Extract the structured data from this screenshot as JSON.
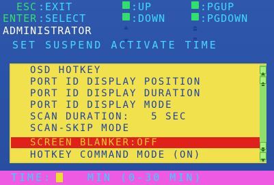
{
  "colors": {
    "background": "#2a52a6",
    "menu_panel": "#f1e24d",
    "menu_text": "#1f41a8",
    "selected_bg": "#e0211b",
    "selected_text": "#f6cd2a",
    "status_bar": "#ee5ae2",
    "hint_cyan": "#3fd8ff",
    "key_green": "#2fe06a"
  },
  "header": {
    "row1": {
      "esc_key": "ESC",
      "esc_action": ":EXIT",
      "up_icon": "up-arrow-icon",
      "up_label": ":UP",
      "pgup_icon": "page-up-icon",
      "pgup_label": ":PGUP"
    },
    "row2": {
      "enter_key": "ENTER",
      "enter_action": ":SELECT",
      "down_icon": "down-arrow-icon",
      "down_label": ":DOWN",
      "pgdown_icon": "page-down-icon",
      "pgdown_label": ":PGDOWN"
    }
  },
  "user": "ADMINISTRATOR",
  "screen_title": "SET SUSPEND ACTIVATE TIME",
  "menu": {
    "items": [
      {
        "label": "OSD HOTKEY",
        "selected": false
      },
      {
        "label": "PORT ID DISPLAY POSITION",
        "selected": false
      },
      {
        "label": "PORT ID DISPLAY DURATION",
        "selected": false
      },
      {
        "label": "PORT ID DISPLAY MODE",
        "selected": false
      },
      {
        "label": "SCAN DURATION:   5 SEC",
        "selected": false
      },
      {
        "label": "SCAN-SKIP MODE",
        "selected": false
      },
      {
        "label": "SCREEN BLANKER:OFF",
        "selected": true
      },
      {
        "label": "HOTKEY COMMAND MODE (ON)",
        "selected": false
      }
    ]
  },
  "status": {
    "time_label": "TIME:",
    "time_value": "",
    "range_text": "MIN (0-30 MIN)"
  }
}
